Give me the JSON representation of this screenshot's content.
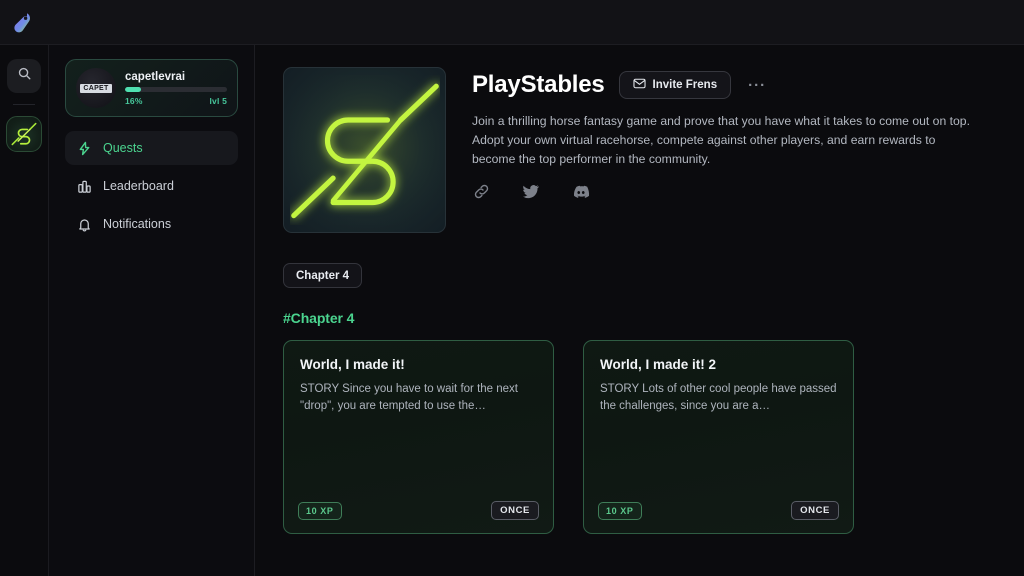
{
  "rail": {
    "logo_icon": "app-logo-icon",
    "search_icon": "search-icon",
    "server_icon": "playstables-server-icon"
  },
  "sidebar": {
    "profile": {
      "avatar_text": "CAPET",
      "username": "capetlevrai",
      "progress_label": "16%",
      "progress_percent": 16,
      "level_label": "lvl 5"
    },
    "nav": [
      {
        "label": "Quests",
        "icon": "lightning-bolt-icon",
        "active": true
      },
      {
        "label": "Leaderboard",
        "icon": "bar-chart-icon",
        "active": false
      },
      {
        "label": "Notifications",
        "icon": "bell-icon",
        "active": false
      }
    ]
  },
  "main": {
    "hero_icon": "playstables-logo-icon",
    "title": "PlayStables",
    "invite_label": "Invite Frens",
    "invite_icon": "envelope-icon",
    "more_label": "···",
    "description": "Join a thrilling horse fantasy game and prove that you have what it takes to come out on top. Adopt your own virtual racehorse, compete against other players, and earn rewards to become the top performer in the community.",
    "socials": [
      {
        "name": "link-icon"
      },
      {
        "name": "twitter-icon"
      },
      {
        "name": "discord-icon"
      }
    ],
    "chapter_tab": "Chapter 4",
    "chapter_heading": "#Chapter 4",
    "quests": [
      {
        "title": "World, I made it!",
        "description": "STORY Since you have to wait for the next \"drop\", you are tempted to use the…",
        "xp": "10 XP",
        "frequency": "ONCE"
      },
      {
        "title": "World, I made it! 2",
        "description": "STORY Lots of other cool people have passed the challenges, since you are a…",
        "xp": "10 XP",
        "frequency": "ONCE"
      }
    ]
  },
  "colors": {
    "accent_green": "#4bd48f",
    "progress_teal": "#4fe0b0",
    "card_border": "#2f5d43",
    "background": "#0b0b0e"
  }
}
